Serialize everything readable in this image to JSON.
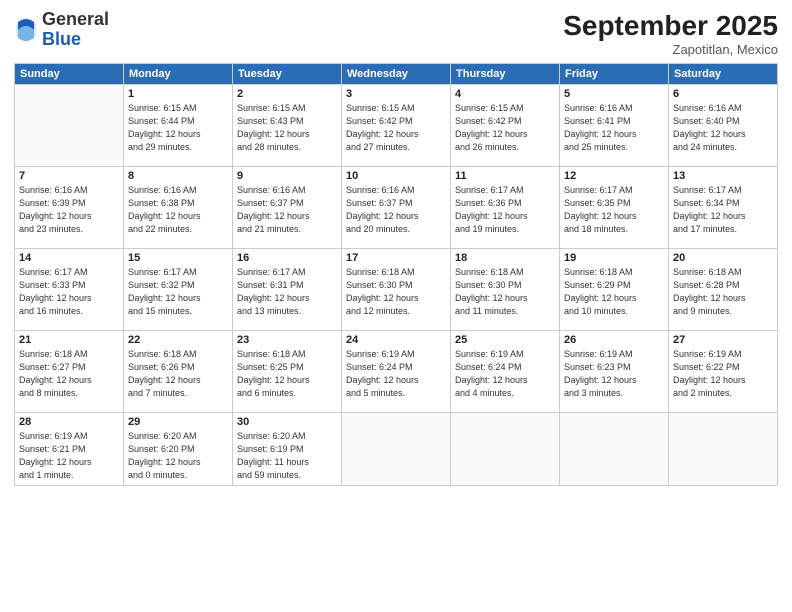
{
  "logo": {
    "general": "General",
    "blue": "Blue"
  },
  "header": {
    "month": "September 2025",
    "location": "Zapotitlan, Mexico"
  },
  "weekdays": [
    "Sunday",
    "Monday",
    "Tuesday",
    "Wednesday",
    "Thursday",
    "Friday",
    "Saturday"
  ],
  "weeks": [
    [
      {
        "num": "",
        "info": ""
      },
      {
        "num": "1",
        "info": "Sunrise: 6:15 AM\nSunset: 6:44 PM\nDaylight: 12 hours\nand 29 minutes."
      },
      {
        "num": "2",
        "info": "Sunrise: 6:15 AM\nSunset: 6:43 PM\nDaylight: 12 hours\nand 28 minutes."
      },
      {
        "num": "3",
        "info": "Sunrise: 6:15 AM\nSunset: 6:42 PM\nDaylight: 12 hours\nand 27 minutes."
      },
      {
        "num": "4",
        "info": "Sunrise: 6:15 AM\nSunset: 6:42 PM\nDaylight: 12 hours\nand 26 minutes."
      },
      {
        "num": "5",
        "info": "Sunrise: 6:16 AM\nSunset: 6:41 PM\nDaylight: 12 hours\nand 25 minutes."
      },
      {
        "num": "6",
        "info": "Sunrise: 6:16 AM\nSunset: 6:40 PM\nDaylight: 12 hours\nand 24 minutes."
      }
    ],
    [
      {
        "num": "7",
        "info": "Sunrise: 6:16 AM\nSunset: 6:39 PM\nDaylight: 12 hours\nand 23 minutes."
      },
      {
        "num": "8",
        "info": "Sunrise: 6:16 AM\nSunset: 6:38 PM\nDaylight: 12 hours\nand 22 minutes."
      },
      {
        "num": "9",
        "info": "Sunrise: 6:16 AM\nSunset: 6:37 PM\nDaylight: 12 hours\nand 21 minutes."
      },
      {
        "num": "10",
        "info": "Sunrise: 6:16 AM\nSunset: 6:37 PM\nDaylight: 12 hours\nand 20 minutes."
      },
      {
        "num": "11",
        "info": "Sunrise: 6:17 AM\nSunset: 6:36 PM\nDaylight: 12 hours\nand 19 minutes."
      },
      {
        "num": "12",
        "info": "Sunrise: 6:17 AM\nSunset: 6:35 PM\nDaylight: 12 hours\nand 18 minutes."
      },
      {
        "num": "13",
        "info": "Sunrise: 6:17 AM\nSunset: 6:34 PM\nDaylight: 12 hours\nand 17 minutes."
      }
    ],
    [
      {
        "num": "14",
        "info": "Sunrise: 6:17 AM\nSunset: 6:33 PM\nDaylight: 12 hours\nand 16 minutes."
      },
      {
        "num": "15",
        "info": "Sunrise: 6:17 AM\nSunset: 6:32 PM\nDaylight: 12 hours\nand 15 minutes."
      },
      {
        "num": "16",
        "info": "Sunrise: 6:17 AM\nSunset: 6:31 PM\nDaylight: 12 hours\nand 13 minutes."
      },
      {
        "num": "17",
        "info": "Sunrise: 6:18 AM\nSunset: 6:30 PM\nDaylight: 12 hours\nand 12 minutes."
      },
      {
        "num": "18",
        "info": "Sunrise: 6:18 AM\nSunset: 6:30 PM\nDaylight: 12 hours\nand 11 minutes."
      },
      {
        "num": "19",
        "info": "Sunrise: 6:18 AM\nSunset: 6:29 PM\nDaylight: 12 hours\nand 10 minutes."
      },
      {
        "num": "20",
        "info": "Sunrise: 6:18 AM\nSunset: 6:28 PM\nDaylight: 12 hours\nand 9 minutes."
      }
    ],
    [
      {
        "num": "21",
        "info": "Sunrise: 6:18 AM\nSunset: 6:27 PM\nDaylight: 12 hours\nand 8 minutes."
      },
      {
        "num": "22",
        "info": "Sunrise: 6:18 AM\nSunset: 6:26 PM\nDaylight: 12 hours\nand 7 minutes."
      },
      {
        "num": "23",
        "info": "Sunrise: 6:18 AM\nSunset: 6:25 PM\nDaylight: 12 hours\nand 6 minutes."
      },
      {
        "num": "24",
        "info": "Sunrise: 6:19 AM\nSunset: 6:24 PM\nDaylight: 12 hours\nand 5 minutes."
      },
      {
        "num": "25",
        "info": "Sunrise: 6:19 AM\nSunset: 6:24 PM\nDaylight: 12 hours\nand 4 minutes."
      },
      {
        "num": "26",
        "info": "Sunrise: 6:19 AM\nSunset: 6:23 PM\nDaylight: 12 hours\nand 3 minutes."
      },
      {
        "num": "27",
        "info": "Sunrise: 6:19 AM\nSunset: 6:22 PM\nDaylight: 12 hours\nand 2 minutes."
      }
    ],
    [
      {
        "num": "28",
        "info": "Sunrise: 6:19 AM\nSunset: 6:21 PM\nDaylight: 12 hours\nand 1 minute."
      },
      {
        "num": "29",
        "info": "Sunrise: 6:20 AM\nSunset: 6:20 PM\nDaylight: 12 hours\nand 0 minutes."
      },
      {
        "num": "30",
        "info": "Sunrise: 6:20 AM\nSunset: 6:19 PM\nDaylight: 11 hours\nand 59 minutes."
      },
      {
        "num": "",
        "info": ""
      },
      {
        "num": "",
        "info": ""
      },
      {
        "num": "",
        "info": ""
      },
      {
        "num": "",
        "info": ""
      }
    ]
  ]
}
